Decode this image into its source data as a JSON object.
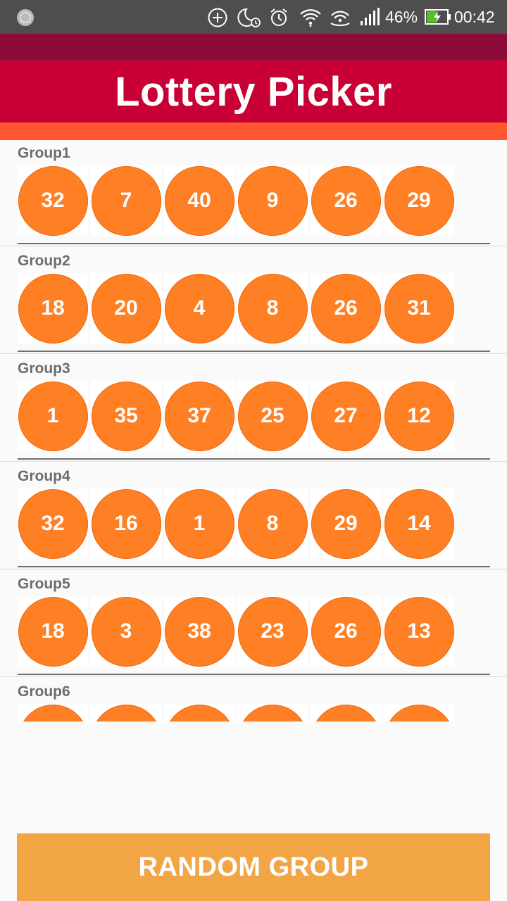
{
  "status_bar": {
    "battery_percent": "46%",
    "time": "00:42",
    "icons": [
      "app-icon",
      "add-circle-icon",
      "night-mode-icon",
      "alarm-icon",
      "wifi-icon",
      "hotspot-icon",
      "signal-icon",
      "battery-charging-icon"
    ]
  },
  "app": {
    "title": "Lottery Picker"
  },
  "colors": {
    "status_bar": "#4e4e4e",
    "app_bar_dark": "#8c0b38",
    "title_bar": "#c90036",
    "accent_bar": "#ff5630",
    "ball": "#ff7f24",
    "button": "#f2a545"
  },
  "groups": [
    {
      "label": "Group1",
      "numbers": [
        "32",
        "7",
        "40",
        "9",
        "26",
        "29"
      ]
    },
    {
      "label": "Group2",
      "numbers": [
        "18",
        "20",
        "4",
        "8",
        "26",
        "31"
      ]
    },
    {
      "label": "Group3",
      "numbers": [
        "1",
        "35",
        "37",
        "25",
        "27",
        "12"
      ]
    },
    {
      "label": "Group4",
      "numbers": [
        "32",
        "16",
        "1",
        "8",
        "29",
        "14"
      ]
    },
    {
      "label": "Group5",
      "numbers": [
        "18",
        "3",
        "38",
        "23",
        "26",
        "13"
      ]
    },
    {
      "label": "Group6",
      "numbers": [
        "",
        "",
        "",
        "",
        "",
        ""
      ]
    }
  ],
  "button": {
    "label": "RANDOM GROUP"
  }
}
